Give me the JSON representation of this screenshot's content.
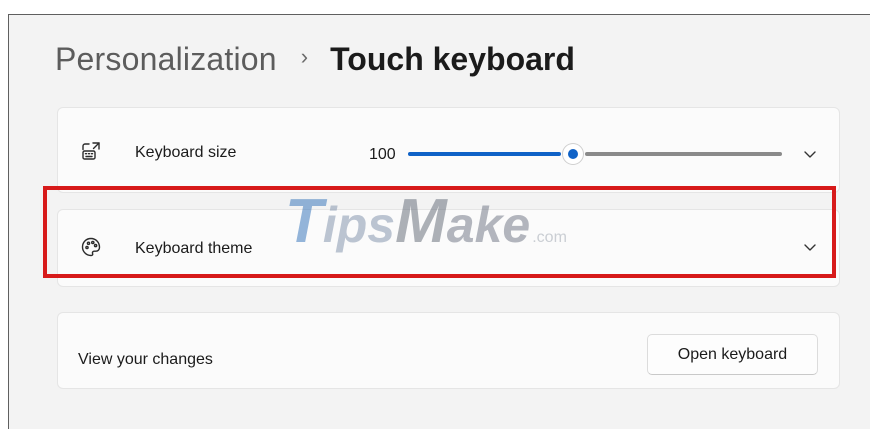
{
  "breadcrumb": {
    "parent": "Personalization",
    "separator": "›",
    "current": "Touch keyboard"
  },
  "settings": {
    "keyboard_size": {
      "label": "Keyboard size",
      "icon": "keyboard-resize-icon",
      "value": "100",
      "slider_fraction": 0.44
    },
    "keyboard_theme": {
      "label": "Keyboard theme",
      "icon": "palette-icon"
    },
    "view_changes": {
      "label": "View your changes",
      "button_label": "Open keyboard"
    }
  },
  "watermark": {
    "t": "T",
    "ips": "ips",
    "m": "M",
    "ake": "ake",
    "com": ".com"
  },
  "colors": {
    "accent": "#0f62c7",
    "highlight": "#d71a1a",
    "background": "#f3f3f3",
    "card": "#fbfbfb"
  }
}
